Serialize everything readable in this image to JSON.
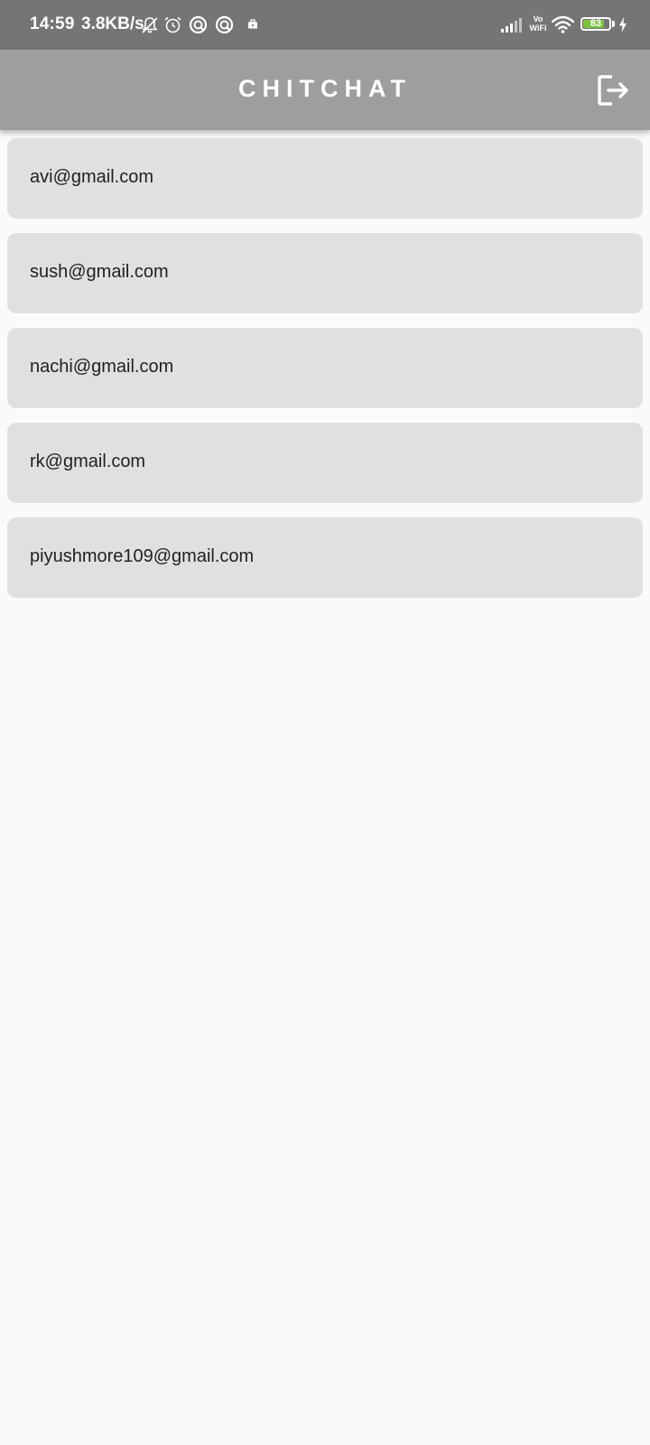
{
  "status_bar": {
    "time": "14:59",
    "speed": "3.8KB/s",
    "vowifi_top": "Vo",
    "vowifi_bottom": "WiFi",
    "battery": "83",
    "battery_fraction": 0.83,
    "icons": [
      "notifications-off-icon",
      "alarm-icon",
      "app-notification-icon",
      "app-notification-icon",
      "briefcase-icon",
      "signal-icon",
      "wifi-icon",
      "battery-icon",
      "charging-icon"
    ]
  },
  "app_bar": {
    "title": "CHITCHAT",
    "action_icon": "logout-icon",
    "color": "#9e9e9e"
  },
  "users": [
    {
      "email": "avi@gmail.com"
    },
    {
      "email": "sush@gmail.com"
    },
    {
      "email": "nachi@gmail.com"
    },
    {
      "email": "rk@gmail.com"
    },
    {
      "email": "piyushmore109@gmail.com"
    }
  ],
  "colors": {
    "background": "#fafafa",
    "card": "#e0e0e0",
    "status_bar": "#757575",
    "text": "#212121"
  }
}
